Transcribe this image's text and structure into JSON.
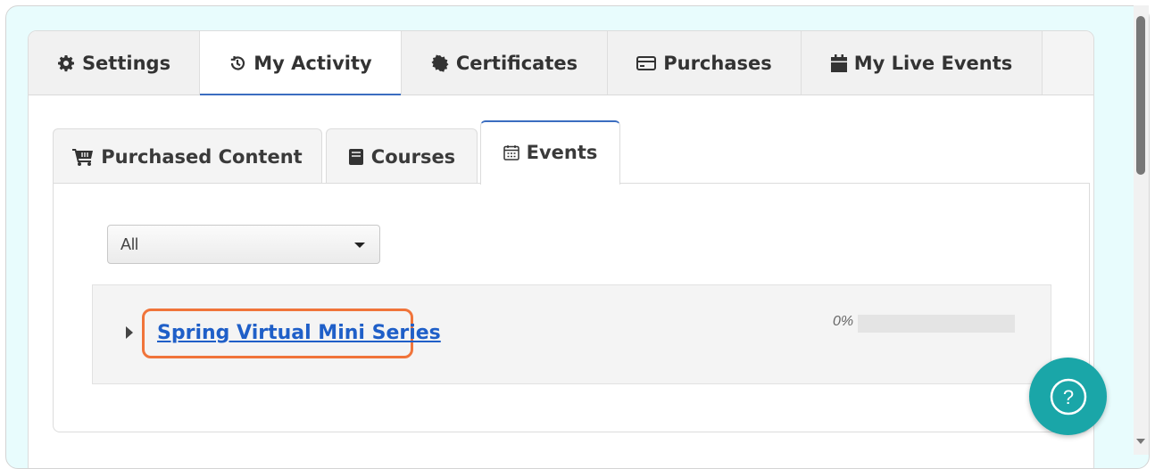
{
  "top_tabs": [
    {
      "label": "Settings",
      "icon": "gear-icon",
      "active": false
    },
    {
      "label": "My Activity",
      "icon": "history-icon",
      "active": true
    },
    {
      "label": "Certificates",
      "icon": "certificate-icon",
      "active": false
    },
    {
      "label": "Purchases",
      "icon": "credit-card-icon",
      "active": false
    },
    {
      "label": "My Live Events",
      "icon": "calendar-icon",
      "active": false
    }
  ],
  "sub_tabs": [
    {
      "label": "Purchased Content",
      "icon": "cart-icon",
      "active": false
    },
    {
      "label": "Courses",
      "icon": "book-icon",
      "active": false
    },
    {
      "label": "Events",
      "icon": "calendar-outline-icon",
      "active": true
    }
  ],
  "filter": {
    "selected": "All"
  },
  "events": [
    {
      "title": "Spring Virtual Mini Series",
      "progress_label": "0%",
      "progress_fraction": 0
    }
  ],
  "help": {
    "icon": "question-icon",
    "label": "?"
  },
  "colors": {
    "accent": "#3b6dc0",
    "link": "#1f5fc8",
    "highlight": "#f0743a",
    "help": "#1aa6a8",
    "frame": "#e8fcfd"
  }
}
